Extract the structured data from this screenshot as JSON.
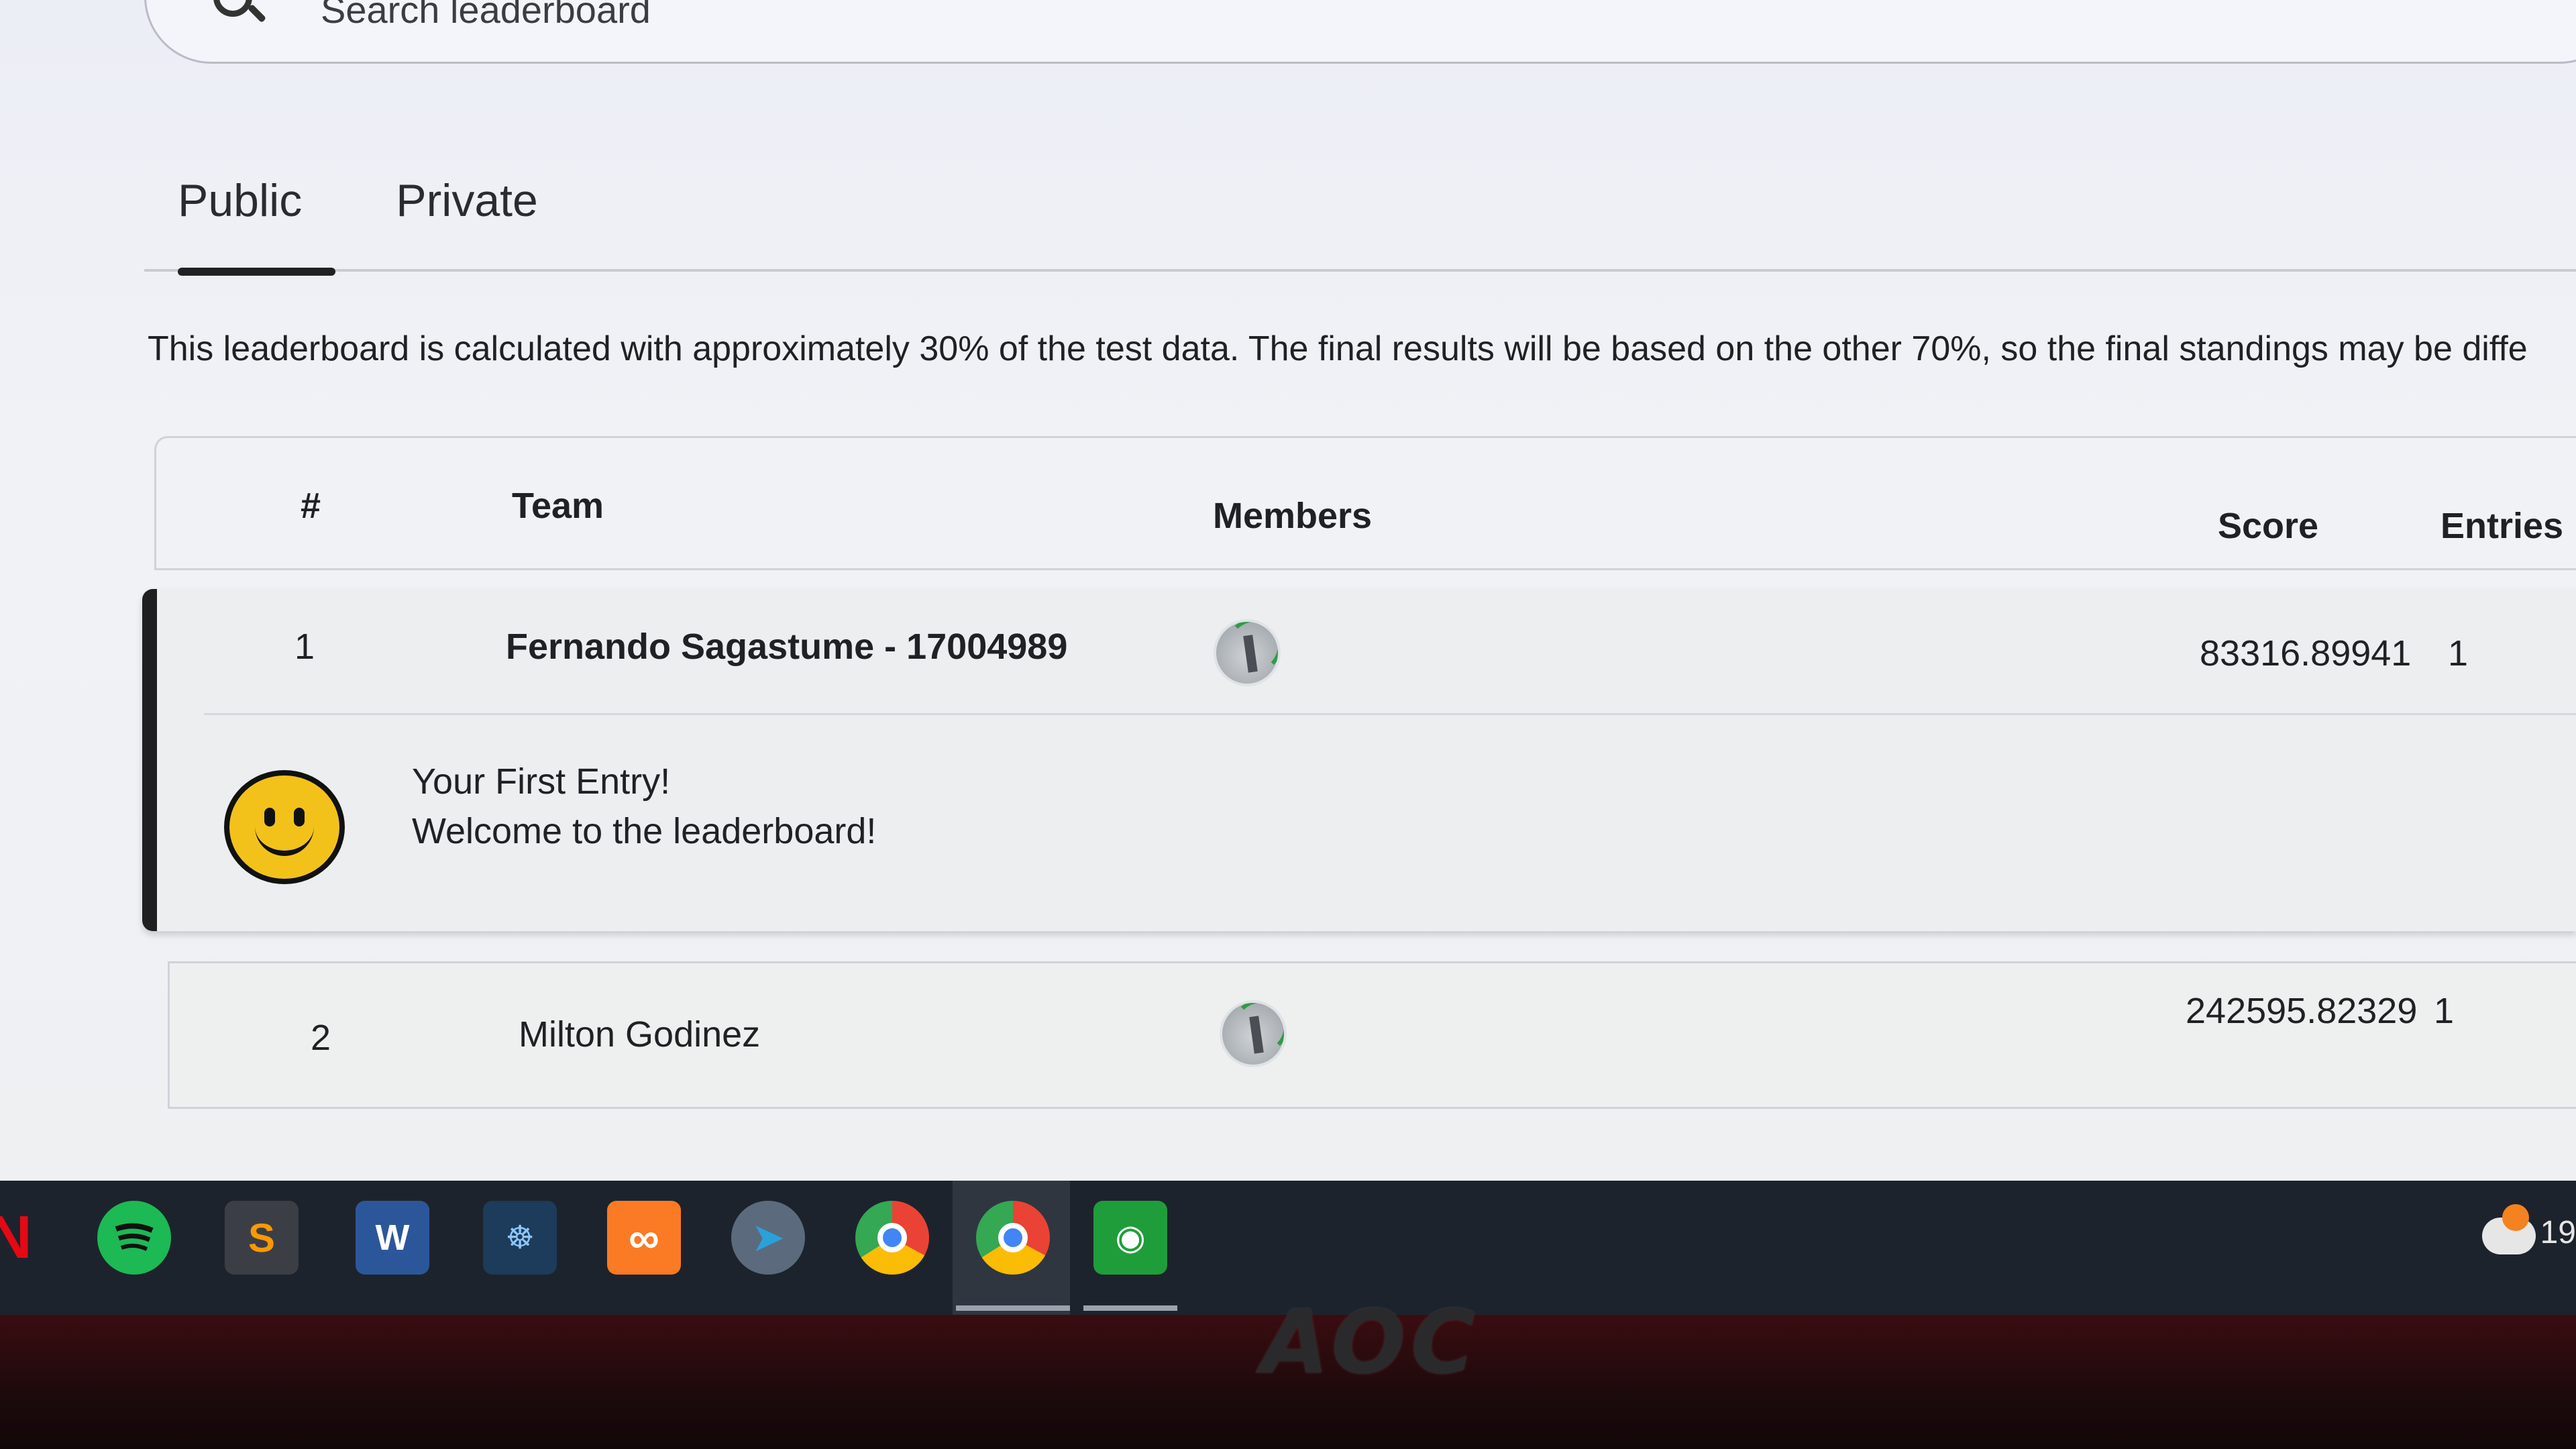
{
  "search": {
    "placeholder": "Search leaderboard"
  },
  "tabs": [
    {
      "label": "Public",
      "active": true
    },
    {
      "label": "Private",
      "active": false
    }
  ],
  "notice": "This leaderboard is calculated with approximately 30% of the test data. The final results will be based on the other 70%, so the final standings may be diffe",
  "table": {
    "headers": {
      "rank": "#",
      "team": "Team",
      "members": "Members",
      "score": "Score",
      "entries": "Entries"
    },
    "rows": [
      {
        "rank": "1",
        "team": "Fernando Sagastume - 17004989",
        "score": "83316.89941",
        "entries": "1",
        "highlighted": true
      },
      {
        "rank": "2",
        "team": "Milton Godinez",
        "score": "242595.82329",
        "entries": "1",
        "highlighted": false
      }
    ],
    "first_entry": {
      "line1": "Your First Entry!",
      "line2": "Welcome to the leaderboard!"
    }
  },
  "taskbar": {
    "icons": [
      "netflix-icon",
      "spotify-icon",
      "sublime-text-icon",
      "word-icon",
      "mysql-workbench-icon",
      "xampp-icon",
      "telegram-icon",
      "chrome-icon",
      "chrome-icon",
      "eye-app-icon"
    ],
    "tray_time": "19"
  },
  "monitor": {
    "brand": "AOC"
  },
  "colors": {
    "accent": "#202124",
    "highlight_bar": "#1f1f22",
    "smiley": "#f2c21b"
  }
}
